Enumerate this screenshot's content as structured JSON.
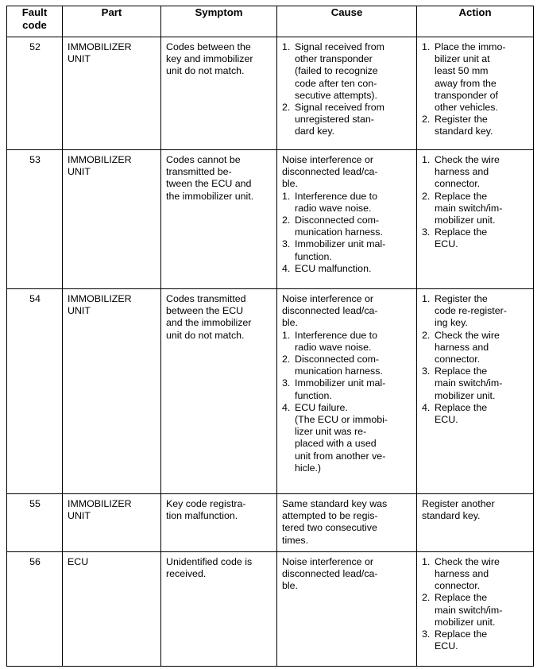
{
  "table": {
    "name": "fault-code-diagnostic-table",
    "headers": [
      "Fault\ncode",
      "Part",
      "Symptom",
      "Cause",
      "Action"
    ],
    "rows": [
      {
        "code": "52",
        "part": "IMMOBILIZER\nUNIT",
        "symptom": "Codes between the\nkey and immobilizer\nunit do not match.",
        "cause_intro": "",
        "cause_items": [
          "Signal received from\nother transponder\n(failed to recognize\ncode after ten con-\nsecutive attempts).",
          "Signal received from\nunregistered stan-\ndard key."
        ],
        "cause_tail": "",
        "action_intro": "",
        "action_items": [
          "Place the immo-\nbilizer unit at\nleast 50 mm\naway from the\ntransponder of\nother vehicles.",
          "Register the\nstandard key."
        ]
      },
      {
        "code": "53",
        "part": "IMMOBILIZER\nUNIT",
        "symptom": "Codes cannot be\ntransmitted be-\ntween the ECU and\nthe immobilizer unit.",
        "cause_intro": "Noise interference or\ndisconnected lead/ca-\nble.",
        "cause_items": [
          "Interference due to\nradio wave noise.",
          "Disconnected com-\nmunication harness.",
          "Immobilizer unit mal-\nfunction.",
          "ECU malfunction."
        ],
        "cause_tail": "",
        "action_intro": "",
        "action_items": [
          "Check the wire\nharness and\nconnector.",
          "Replace the\nmain switch/im-\nmobilizer unit.",
          "Replace the\nECU."
        ]
      },
      {
        "code": "54",
        "part": "IMMOBILIZER\nUNIT",
        "symptom": "Codes transmitted\nbetween the ECU\nand the immobilizer\nunit do not match.",
        "cause_intro": "Noise interference or\ndisconnected lead/ca-\nble.",
        "cause_items": [
          "Interference due to\nradio wave noise.",
          "Disconnected com-\nmunication harness.",
          "Immobilizer unit mal-\nfunction.",
          "ECU failure."
        ],
        "cause_tail": "(The ECU or immobi-\nlizer unit was re-\nplaced with a used\nunit from another ve-\nhicle.)",
        "action_intro": "",
        "action_items": [
          "Register the\ncode re-register-\ning key.",
          "Check the wire\nharness and\nconnector.",
          "Replace the\nmain switch/im-\nmobilizer unit.",
          "Replace the\nECU."
        ]
      },
      {
        "code": "55",
        "part": "IMMOBILIZER\nUNIT",
        "symptom": "Key code registra-\ntion malfunction.",
        "cause_intro": "Same standard key was\nattempted to be regis-\ntered two consecutive\ntimes.",
        "cause_items": [],
        "cause_tail": "",
        "action_intro": "Register another\nstandard key.",
        "action_items": []
      },
      {
        "code": "56",
        "part": "ECU",
        "symptom": "Unidentified code is\nreceived.",
        "cause_intro": "Noise interference or\ndisconnected lead/ca-\nble.",
        "cause_items": [],
        "cause_tail": "",
        "action_intro": "",
        "action_items": [
          "Check the wire\nharness and\nconnector.",
          "Replace the\nmain switch/im-\nmobilizer unit.",
          "Replace the\nECU."
        ]
      }
    ]
  },
  "colors": {
    "border": "#000000",
    "text": "#000000",
    "background": "#ffffff"
  }
}
